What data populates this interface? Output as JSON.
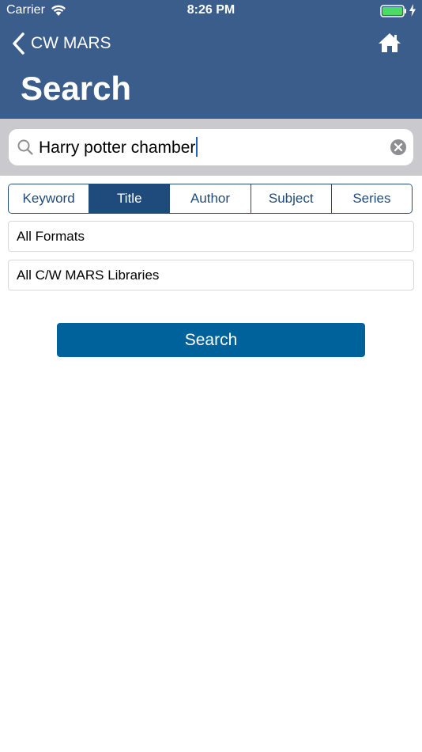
{
  "status_bar": {
    "carrier": "Carrier",
    "time": "8:26 PM",
    "battery_color": "#4cd964"
  },
  "nav": {
    "back_label": "CW MARS",
    "back_icon": "chevron-left-icon",
    "home_icon": "home-icon",
    "title": "Search"
  },
  "search": {
    "value": "Harry potter chamber",
    "icon": "magnifier-icon",
    "clear_icon": "clear-circle-icon"
  },
  "segments": [
    {
      "label": "Keyword",
      "selected": false
    },
    {
      "label": "Title",
      "selected": true
    },
    {
      "label": "Author",
      "selected": false
    },
    {
      "label": "Subject",
      "selected": false
    },
    {
      "label": "Series",
      "selected": false
    }
  ],
  "filters": {
    "format": "All Formats",
    "library": "All C/W MARS Libraries"
  },
  "actions": {
    "search_label": "Search"
  },
  "colors": {
    "header": "#3a5d8b",
    "segment_accent": "#1f4a7c",
    "button": "#00629b",
    "search_band": "#c9c9ce"
  }
}
